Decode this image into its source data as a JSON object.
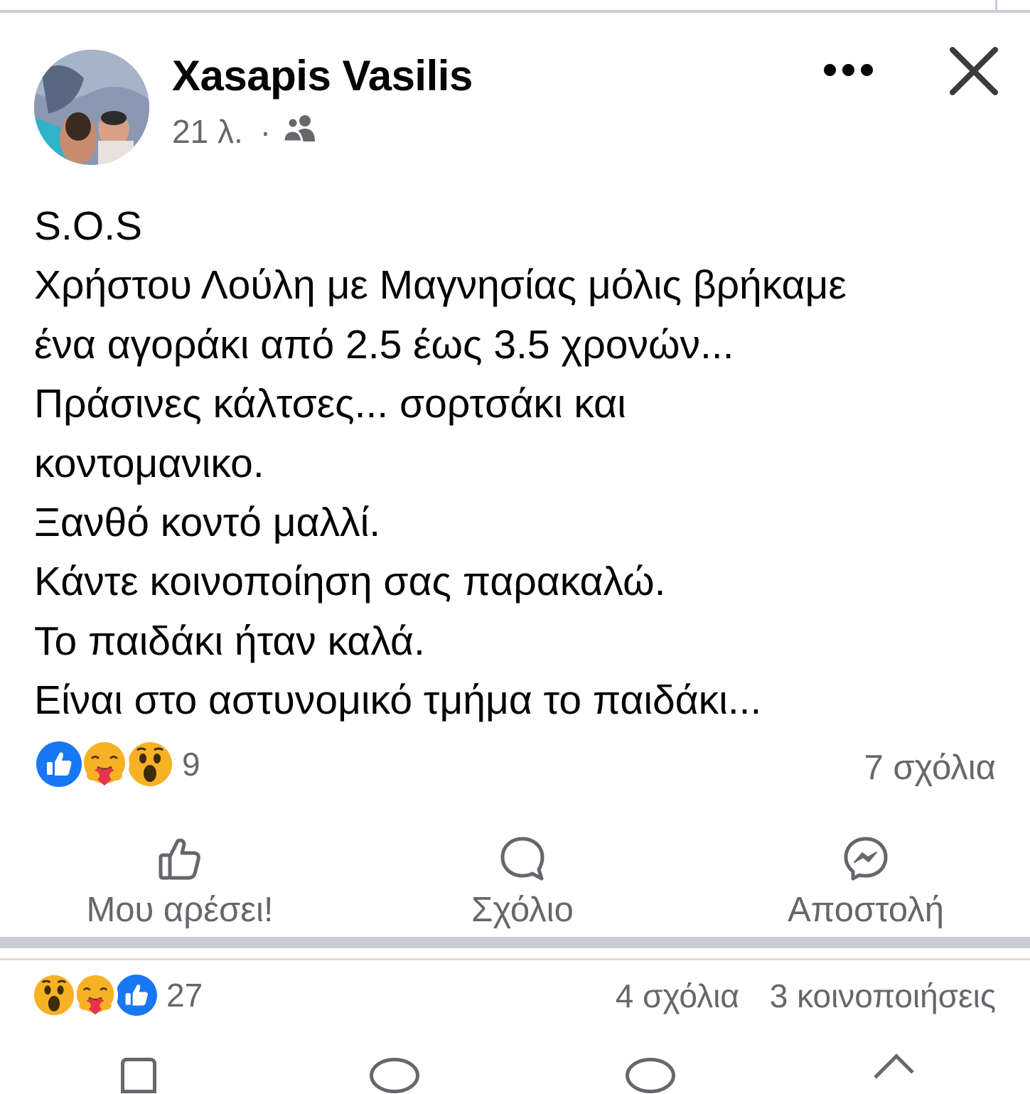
{
  "post": {
    "author": "Xasapis Vasilis",
    "time": "21 λ.",
    "separator": "·",
    "audience_icon": "friends-icon",
    "text_lines": [
      "S.O.S",
      "Χρήστου Λούλη με Μαγνησίας μόλις βρήκαμε",
      "ένα αγοράκι από 2.5 έως 3.5 χρονών...",
      "Πράσινες κάλτσες... σορτσάκι και",
      "κοντομανικο.",
      "Ξανθό κοντό μαλλί.",
      "Κάντε κοινοποίηση σας παρακαλώ.",
      "Το παιδάκι ήταν καλά.",
      "Είναι στο αστυνομικό τμήμα το παιδάκι..."
    ],
    "reaction_icons": [
      "like-icon",
      "care-icon",
      "wow-icon"
    ],
    "reaction_count": "9",
    "comments": "7 σχόλια",
    "actions": {
      "like": "Μου αρέσει!",
      "comment": "Σχόλιο",
      "send": "Αποστολή"
    }
  },
  "next_post": {
    "reaction_icons": [
      "wow-icon",
      "care-icon",
      "like-icon"
    ],
    "reaction_count": "27",
    "comments": "4 σχόλια",
    "shares": "3 κοινοποιήσεις"
  },
  "colors": {
    "like_blue": "#1877f2",
    "emoji_yellow": "#f7b125",
    "care_red": "#e5344b",
    "secondary_text": "#65676b",
    "divider": "#c9ccd1"
  }
}
